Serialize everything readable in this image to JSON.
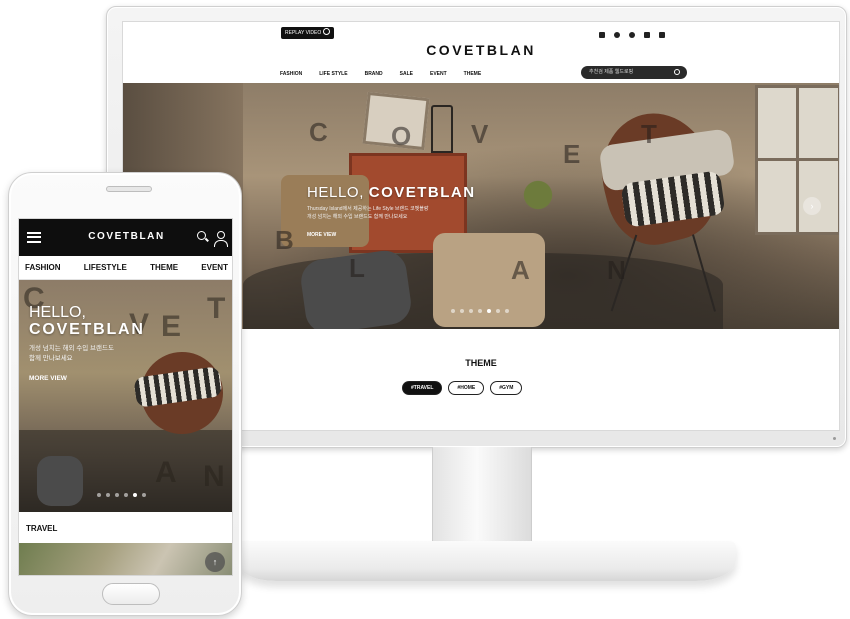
{
  "desktop": {
    "replay_label": "REPLAY VIDEO",
    "logo": "COVETBLAN",
    "nav": [
      "FASHION",
      "LIFE STYLE",
      "BRAND",
      "SALE",
      "EVENT",
      "THEME"
    ],
    "search_placeholder": "추천검 제품 웹드로핑",
    "utility_icons": [
      "user-icon",
      "heart-icon",
      "eye-icon",
      "lock-icon",
      "cart-icon"
    ],
    "hero": {
      "title_prefix": "HELLO,",
      "title_brand": "COVETBLAN",
      "subtitle_line1": "Thursday Island에서 제공하는 Life Style 브랜드 코벳블랑",
      "subtitle_line2": "개성 넘치는 해외 수입 브랜드도 함께 만나보세요",
      "more_view": "MORE VIEW",
      "ghost_letters": [
        "C",
        "O",
        "V",
        "E",
        "T",
        "B",
        "L",
        "A",
        "N"
      ],
      "slide_count": 7,
      "active_slide": 5
    },
    "theme": {
      "title": "THEME",
      "tags": [
        "#TRAVEL",
        "#HOME",
        "#GYM"
      ],
      "active_tag": "#TRAVEL"
    }
  },
  "mobile": {
    "logo": "COVETBLAN",
    "nav": [
      "FASHION",
      "LIFESTYLE",
      "THEME",
      "EVENT"
    ],
    "hero": {
      "title_prefix": "HELLO,",
      "title_brand": "COVETBLAN",
      "subtitle_line1": "개성 넘치는 해외 수입 브랜드도",
      "subtitle_line2": "함께 만나보세요",
      "more_view": "MORE VIEW",
      "slide_count": 6,
      "active_slide": 5
    },
    "section_title": "TRAVEL"
  },
  "colors": {
    "header_bg": "#0e0e0e",
    "accent_dark": "#111111",
    "monitor_frame": "#ececec"
  }
}
